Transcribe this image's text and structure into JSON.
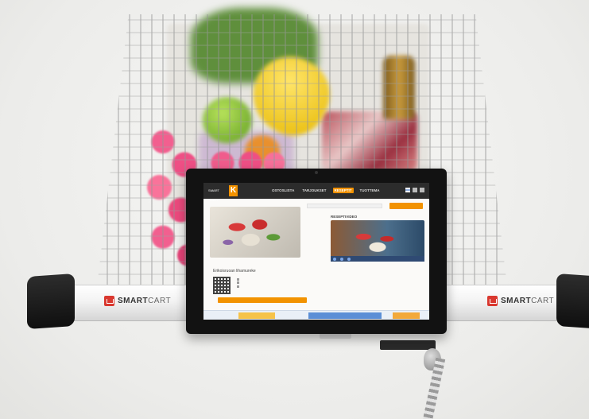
{
  "handle": {
    "brand_left": "SMART",
    "brand_left_thin": "CART",
    "brand_right": "SMART",
    "brand_right_thin": "CART"
  },
  "screen": {
    "logo_text": "SMART CART",
    "k_logo": "K",
    "nav": [
      "OSTOSLISTA",
      "TARJOUKSET",
      "RESEPTIT",
      "TUOTTEMA"
    ],
    "active_nav": "RESEPTIT",
    "search_placeholder": "",
    "search_button": "",
    "section_title": "RESEPTIVIDEO",
    "recipe_title": "Erikoisruoan lihamureke",
    "rating_rows": [
      "",
      "",
      ""
    ],
    "action_button": "",
    "bottom_left": ""
  },
  "colors": {
    "accent_orange": "#f29200",
    "cart_brand_red": "#d9382f",
    "tablet_frame": "#121212"
  }
}
